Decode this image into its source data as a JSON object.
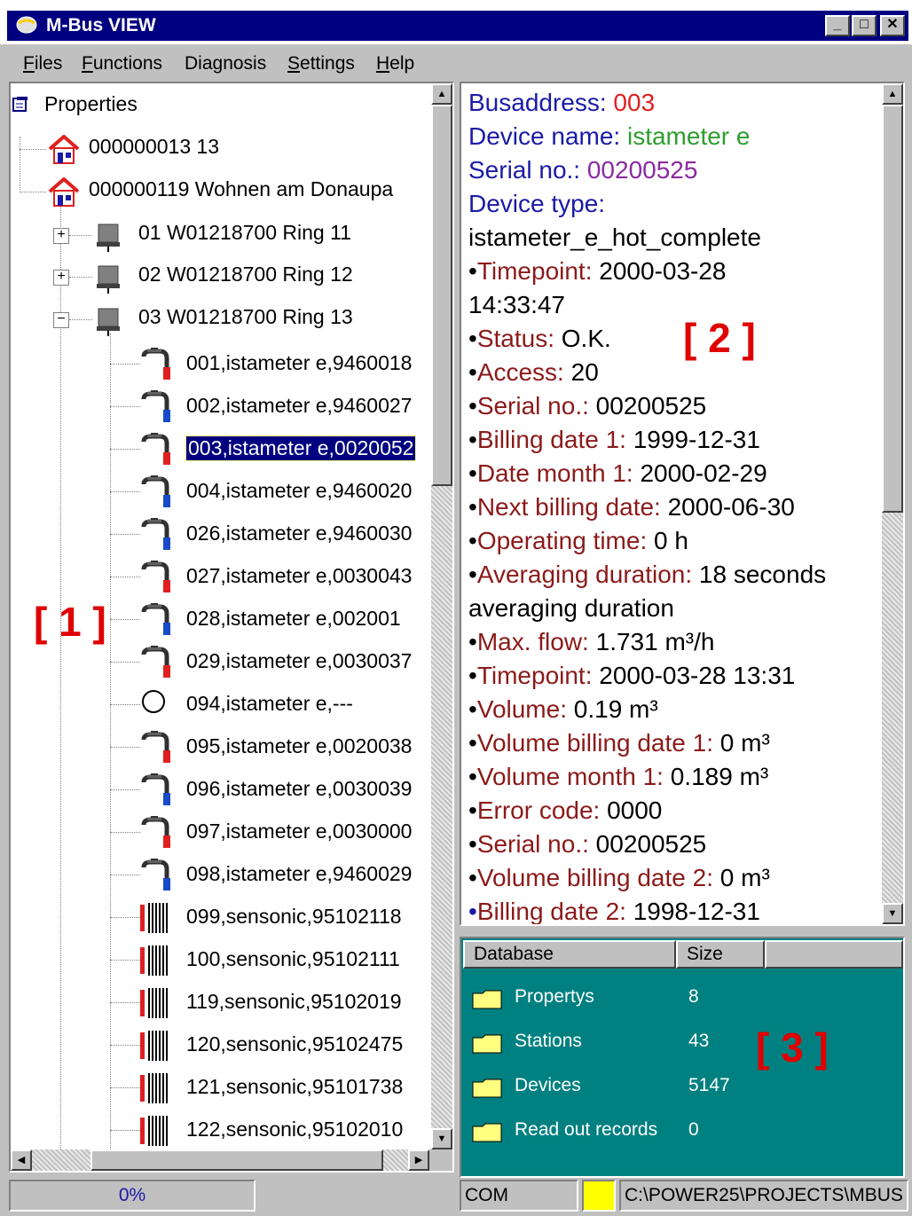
{
  "window": {
    "title": "M-Bus VIEW",
    "minimize": "_",
    "maximize": "□",
    "close": "✕"
  },
  "menu": [
    {
      "label": "Files",
      "ul": "F",
      "rest": "iles"
    },
    {
      "label": "Functions",
      "ul": "F",
      "rest": "unctions"
    },
    {
      "label": "Diagnosis",
      "ul": "",
      "rest": "Diagnosis"
    },
    {
      "label": "Settings",
      "ul": "S",
      "rest": "ettings"
    },
    {
      "label": "Help",
      "ul": "H",
      "rest": "elp"
    }
  ],
  "tree": {
    "root": "Properties",
    "properties": [
      {
        "label": "000000013 13",
        "icon": "house-icon"
      },
      {
        "label": "000000119 Wohnen am Donaupa",
        "icon": "house-icon"
      }
    ],
    "stations": [
      {
        "label": "01 W01218700 Ring 11",
        "expander": "+"
      },
      {
        "label": "02 W01218700 Ring 12",
        "expander": "+"
      },
      {
        "label": "03 W01218700 Ring 13",
        "expander": "−"
      }
    ],
    "devices": [
      {
        "label": "001,istameter e,9460018",
        "icon": "hot-tap-icon"
      },
      {
        "label": "002,istameter e,9460027",
        "icon": "cold-tap-icon"
      },
      {
        "label": "003,istameter e,0020052",
        "icon": "hot-tap-icon",
        "selected": true
      },
      {
        "label": "004,istameter e,9460020",
        "icon": "cold-tap-icon"
      },
      {
        "label": "026,istameter e,9460030",
        "icon": "cold-tap-icon"
      },
      {
        "label": "027,istameter e,0030043",
        "icon": "hot-tap-icon"
      },
      {
        "label": "028,istameter e,002001",
        "icon": "cold-tap-icon"
      },
      {
        "label": "029,istameter e,0030037",
        "icon": "hot-tap-icon"
      },
      {
        "label": "094,istameter e,---",
        "icon": "circle-icon"
      },
      {
        "label": "095,istameter e,0020038",
        "icon": "hot-tap-icon"
      },
      {
        "label": "096,istameter e,0030039",
        "icon": "cold-tap-icon"
      },
      {
        "label": "097,istameter e,0030000",
        "icon": "hot-tap-icon"
      },
      {
        "label": "098,istameter e,9460029",
        "icon": "cold-tap-icon"
      },
      {
        "label": "099,sensonic,95102118",
        "icon": "radiator-icon"
      },
      {
        "label": "100,sensonic,95102111",
        "icon": "radiator-icon"
      },
      {
        "label": "119,sensonic,95102019",
        "icon": "radiator-icon"
      },
      {
        "label": "120,sensonic,95102475",
        "icon": "radiator-icon"
      },
      {
        "label": "121,sensonic,95101738",
        "icon": "radiator-icon"
      },
      {
        "label": "122,sensonic,95102010",
        "icon": "radiator-icon"
      }
    ]
  },
  "details": {
    "busaddress_label": "Busaddress:",
    "busaddress": "003",
    "device_name_label": "Device name:",
    "device_name": "istameter e",
    "serial_label": "Serial no.:",
    "serial": "00200525",
    "device_type_label": "Device type:",
    "device_type": "istameter_e_hot_complete",
    "bullet": "•",
    "records": [
      {
        "label": "Timepoint:",
        "value": "2000-03-28"
      },
      {
        "label": "",
        "value": "14:33:47",
        "continuation": true
      },
      {
        "label": "Status:",
        "value": "O.K."
      },
      {
        "label": "Access:",
        "value": "20"
      },
      {
        "label": "Serial no.:",
        "value": "00200525"
      },
      {
        "label": "Billing date 1:",
        "value": "1999-12-31"
      },
      {
        "label": "Date month 1:",
        "value": "2000-02-29"
      },
      {
        "label": "Next billing date:",
        "value": "2000-06-30"
      },
      {
        "label": "Operating time:",
        "value": "0 h"
      },
      {
        "label": "Averaging duration:",
        "value": "18 seconds"
      },
      {
        "label": "",
        "value": "averaging duration",
        "continuation": true
      },
      {
        "label": "Max. flow:",
        "value": "1.731 m³/h"
      },
      {
        "label": "Timepoint:",
        "value": "2000-03-28 13:31"
      },
      {
        "label": "Volume:",
        "value": "0.19 m³"
      },
      {
        "label": "Volume billing date 1:",
        "value": "0 m³"
      },
      {
        "label": "Volume month 1:",
        "value": "0.189 m³"
      },
      {
        "label": "Error code:",
        "value": "0000"
      },
      {
        "label": "Serial no.:",
        "value": "00200525"
      },
      {
        "label": "Volume billing date 2:",
        "value": "0 m³"
      },
      {
        "label": "Billing date 2:",
        "value": "1998-12-31"
      }
    ]
  },
  "database": {
    "headers": {
      "name": "Database",
      "size": "Size"
    },
    "rows": [
      {
        "name": "Propertys",
        "size": "8"
      },
      {
        "name": "Stations",
        "size": "43"
      },
      {
        "name": "Devices",
        "size": "5147"
      },
      {
        "name": "Read out records",
        "size": "0"
      }
    ]
  },
  "annotations": {
    "a1": "[ 1 ]",
    "a2": "[ 2 ]",
    "a3": "[ 3 ]"
  },
  "status": {
    "progress": "0%",
    "progress_value": 0,
    "port": "COM",
    "path": "C:\\POWER25\\PROJECTS\\MBUS"
  },
  "colors": {
    "titlebar": "#000080",
    "db_background": "#008080",
    "annotation": "#e00000",
    "status_indicator": "#ffff00"
  }
}
